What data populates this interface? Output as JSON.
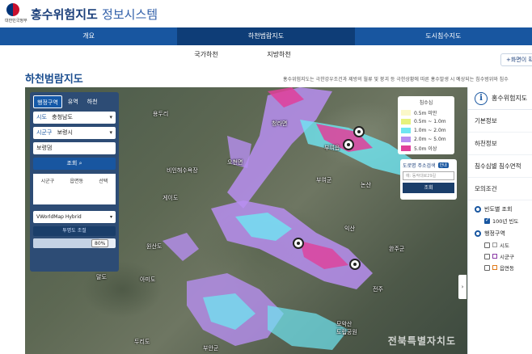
{
  "header": {
    "gov_label": "대한민국정부",
    "title_main": "홍수위험지도",
    "title_sub": "정보시스템"
  },
  "nav": {
    "items": [
      "개요",
      "하천범람지도",
      "도시침수지도"
    ],
    "active": "하천범람지도"
  },
  "subnav": [
    "국가하천",
    "지방하천"
  ],
  "fullscreen_label": "+화면이 확대",
  "page_title": "하천범람지도",
  "description": "홍수위험지도는 극한강우조건과 제방의 월류 및 붕괴 등 극한상황에 따른 홍수발생 시 예상되는 침수범위와 침수",
  "left_panel": {
    "tabs": [
      "행정구역",
      "유역",
      "하천"
    ],
    "sido_label": "시도",
    "sido_value": "충청남도",
    "sigungu_label": "시군구",
    "sigungu_value": "보령시",
    "search_value": "보령댐",
    "query_label": "조회",
    "result_columns": [
      "시군구",
      "읍면동",
      "선택"
    ],
    "basemap_value": "VWorldMap Hybrid",
    "opacity_title": "투명도 조절",
    "opacity_percent": 80,
    "opacity_label": "80%"
  },
  "legend": {
    "title": "침수심",
    "items": [
      {
        "label": "0.5m 미만",
        "color": "#fbf8c8"
      },
      {
        "label": "0.5m ~ 1.0m",
        "color": "#e6f27d"
      },
      {
        "label": "1.0m ~ 2.0m",
        "color": "#6fe6f2"
      },
      {
        "label": "2.0m ~ 5.0m",
        "color": "#b78ef0"
      },
      {
        "label": "5.0m 이상",
        "color": "#e0409a"
      }
    ]
  },
  "address_search": {
    "title": "도로명 주소검색",
    "badge": "안내",
    "placeholder": "예: 동작대로29길",
    "button": "조회"
  },
  "map_places": {
    "p1": "용두리",
    "p2": "비인해수욕장",
    "p3": "게이도",
    "p4": "원산도",
    "p5": "아미도",
    "p6": "오천면",
    "p7": "청라면",
    "p8": "부여군",
    "p9": "논산",
    "p10": "두리도",
    "p11": "부안군",
    "p12": "익산",
    "p13": "완주군",
    "p14": "전주",
    "p15": "모악산",
    "p16": "도립공원",
    "p17": "말도",
    "p18": "부여읍"
  },
  "watermark": "전북특별자치도",
  "right_panel": {
    "header": "홍수위험지도",
    "items": [
      "기본정보",
      "하천정보",
      "침수심별 침수면적",
      "모의조건"
    ],
    "section1_title": "빈도별 조회",
    "section1_checks": [
      {
        "label": "100년 빈도",
        "checked": true
      }
    ],
    "section2_title": "행정구역",
    "section2_checks": [
      {
        "label": "시도",
        "color": "#ffffff",
        "checked": false
      },
      {
        "label": "시군구",
        "color": "#8a3aa6",
        "checked": false
      },
      {
        "label": "읍면동",
        "color": "#e07a1a",
        "checked": false
      }
    ]
  }
}
